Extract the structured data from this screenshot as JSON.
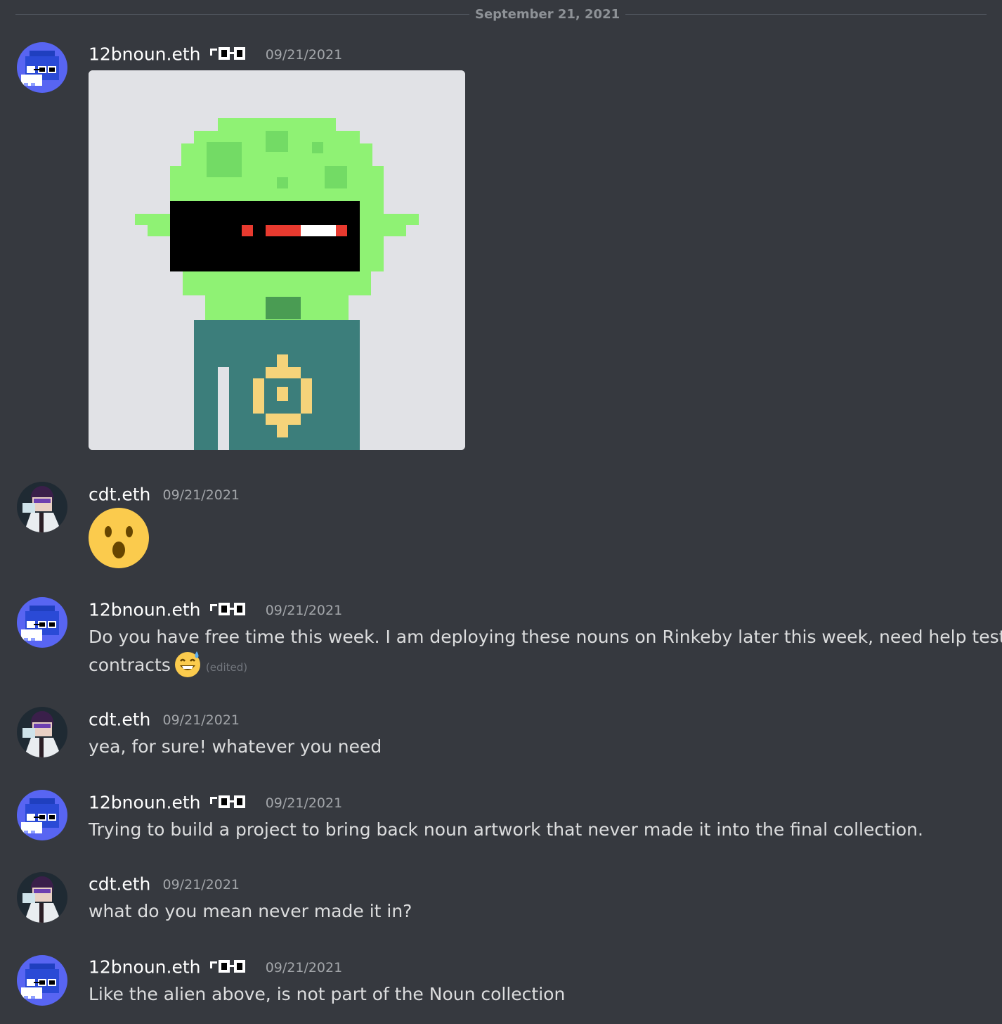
{
  "divider": {
    "date": "September 21, 2021"
  },
  "users": {
    "noun": {
      "name": "12bnoun.eth",
      "badge_icon": "noggles-icon",
      "avatar_color": "#5865f2"
    },
    "cdt": {
      "name": "cdt.eth",
      "avatar_color": "#1f2a33"
    }
  },
  "messages": [
    {
      "author": "12bnoun.eth",
      "timestamp": "09/21/2021",
      "attachment": "alien-noun-image"
    },
    {
      "author": "cdt.eth",
      "timestamp": "09/21/2021",
      "reaction_emoji": "open-mouth-emoji"
    },
    {
      "author": "12bnoun.eth",
      "timestamp": "09/21/2021",
      "text_line1": "Do you have free time this week. I am deploying these nouns on Rinkeby later this week, need help testing",
      "text_line2": "contracts",
      "emoji": "sweat-smile-emoji",
      "edited": "(edited)"
    },
    {
      "author": "cdt.eth",
      "timestamp": "09/21/2021",
      "text": "yea, for sure! whatever you need"
    },
    {
      "author": "12bnoun.eth",
      "timestamp": "09/21/2021",
      "text": "Trying to build a project to bring back noun artwork that never made it into the final collection."
    },
    {
      "author": "cdt.eth",
      "timestamp": "09/21/2021",
      "text": "what do you mean never made it in?"
    },
    {
      "author": "12bnoun.eth",
      "timestamp": "09/21/2021",
      "text": "Like the alien above, is not part of the Noun collection"
    }
  ]
}
